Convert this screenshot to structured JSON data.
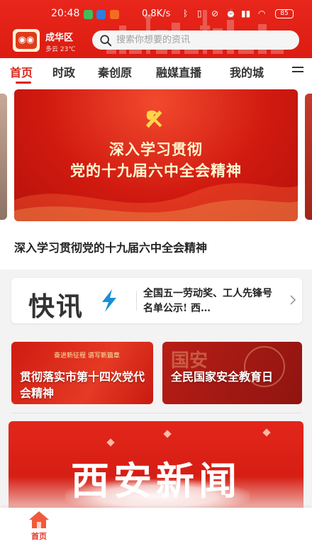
{
  "status_bar": {
    "time": "20:48",
    "network_speed": "0.8K/s",
    "battery": "85"
  },
  "header": {
    "location_name": "成华区",
    "location_sub": "多云 23℃",
    "search_placeholder": "搜索你想要的资讯"
  },
  "tabs": [
    {
      "label": "首页",
      "active": true
    },
    {
      "label": "时政",
      "active": false
    },
    {
      "label": "秦创原",
      "active": false
    },
    {
      "label": "融媒直播",
      "active": false
    },
    {
      "label": "我的城",
      "active": false
    }
  ],
  "carousel": {
    "banner_line1": "深入学习贯彻",
    "banner_line2": "党的十九届六中全会精神",
    "caption": "深入学习贯彻党的十九届六中全会精神"
  },
  "flash_news": {
    "brand": "快讯",
    "text": "全国五一劳动奖、工人先锋号名单公示! 西…"
  },
  "cards": [
    {
      "title": "贯彻落实市第十四次党代会精神",
      "tag": "奋进新征程 谱写新篇章"
    },
    {
      "title": "全民国家安全教育日",
      "stamp": "国安"
    }
  ],
  "news_banner": {
    "title": "西安新闻"
  },
  "bottom_nav": {
    "home_label": "首页"
  },
  "colors": {
    "brand_red": "#d8251a",
    "header_red": "#e9261b"
  }
}
